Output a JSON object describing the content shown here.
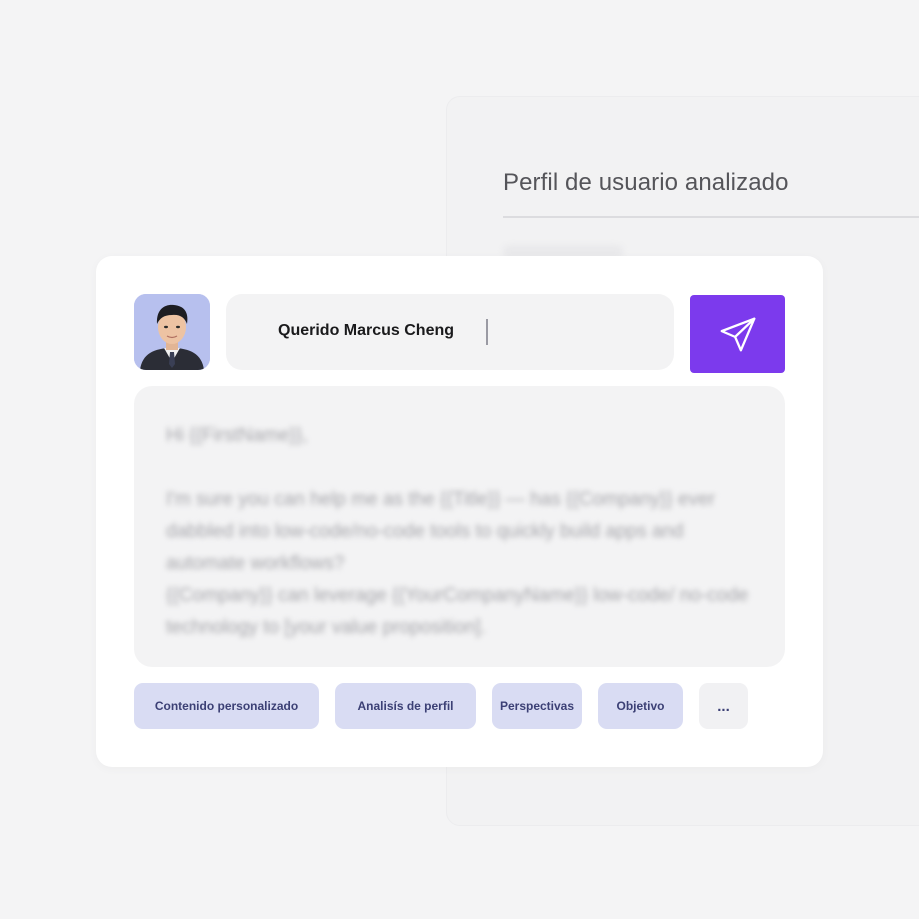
{
  "profile_panel": {
    "title": "Perfil de usuario analizado"
  },
  "composer": {
    "recipient_greeting": "Querido Marcus Cheng",
    "message_body": "Hi {{FirstName}},\n\nI'm sure you can help me as the {{Title}} — has {{Company}} ever dabbled into low-code/no-code tools to quickly build apps and automate workflows?\n{{Company}} can leverage {{YourCompanyName}} low-code/ no-code technology to [your value proposition].",
    "send_icon": "paper-plane-icon"
  },
  "chips": [
    {
      "label": "Contenido personalizado"
    },
    {
      "label": "Analisís de perfil"
    },
    {
      "label": "Perspectivas"
    },
    {
      "label": "Objetivo"
    },
    {
      "label": "..."
    }
  ],
  "colors": {
    "accent": "#7c3aed",
    "chip_bg": "#d9dcf3",
    "chip_text": "#3c4075",
    "page_bg": "#f4f4f5"
  }
}
